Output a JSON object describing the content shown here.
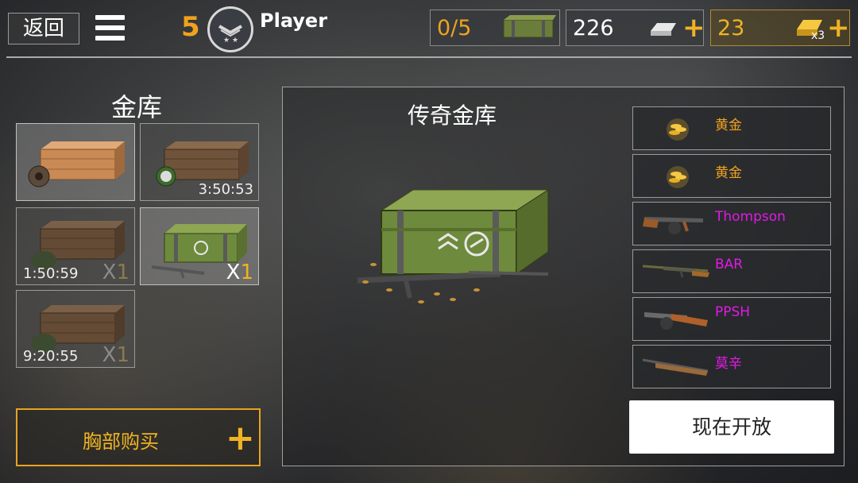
{
  "topbar": {
    "back_label": "返回",
    "level": "5",
    "player_name": "Player",
    "crates_count": "0/5",
    "silver_amount": "226",
    "gold_amount": "23",
    "gold_multiplier": "x3"
  },
  "vault": {
    "title": "金库",
    "slots": [
      {
        "timer": "",
        "count_prefix": "",
        "count_num": ""
      },
      {
        "timer": "3:50:53",
        "count_prefix": "",
        "count_num": ""
      },
      {
        "timer": "1:50:59",
        "count_prefix": "X",
        "count_num": "1"
      },
      {
        "timer": "",
        "count_prefix": "X",
        "count_num": "1"
      },
      {
        "timer": "9:20:55",
        "count_prefix": "X",
        "count_num": "1"
      }
    ],
    "buy_label": "胸部购买"
  },
  "main": {
    "title": "传奇金库",
    "rewards": [
      {
        "name": "黄金",
        "icon": "gold-coins-icon"
      },
      {
        "name": "黄金",
        "icon": "gold-coins-icon"
      },
      {
        "name": "Thompson",
        "icon": "thompson-gun-icon"
      },
      {
        "name": "BAR",
        "icon": "bar-rifle-icon"
      },
      {
        "name": "PPSH",
        "icon": "ppsh-gun-icon"
      },
      {
        "name": "莫辛",
        "icon": "mosin-rifle-icon"
      }
    ],
    "open_label": "现在开放"
  },
  "colors": {
    "accent": "#f0b323",
    "gold_text": "#f0a21f",
    "epic_text": "#e01ae6"
  }
}
